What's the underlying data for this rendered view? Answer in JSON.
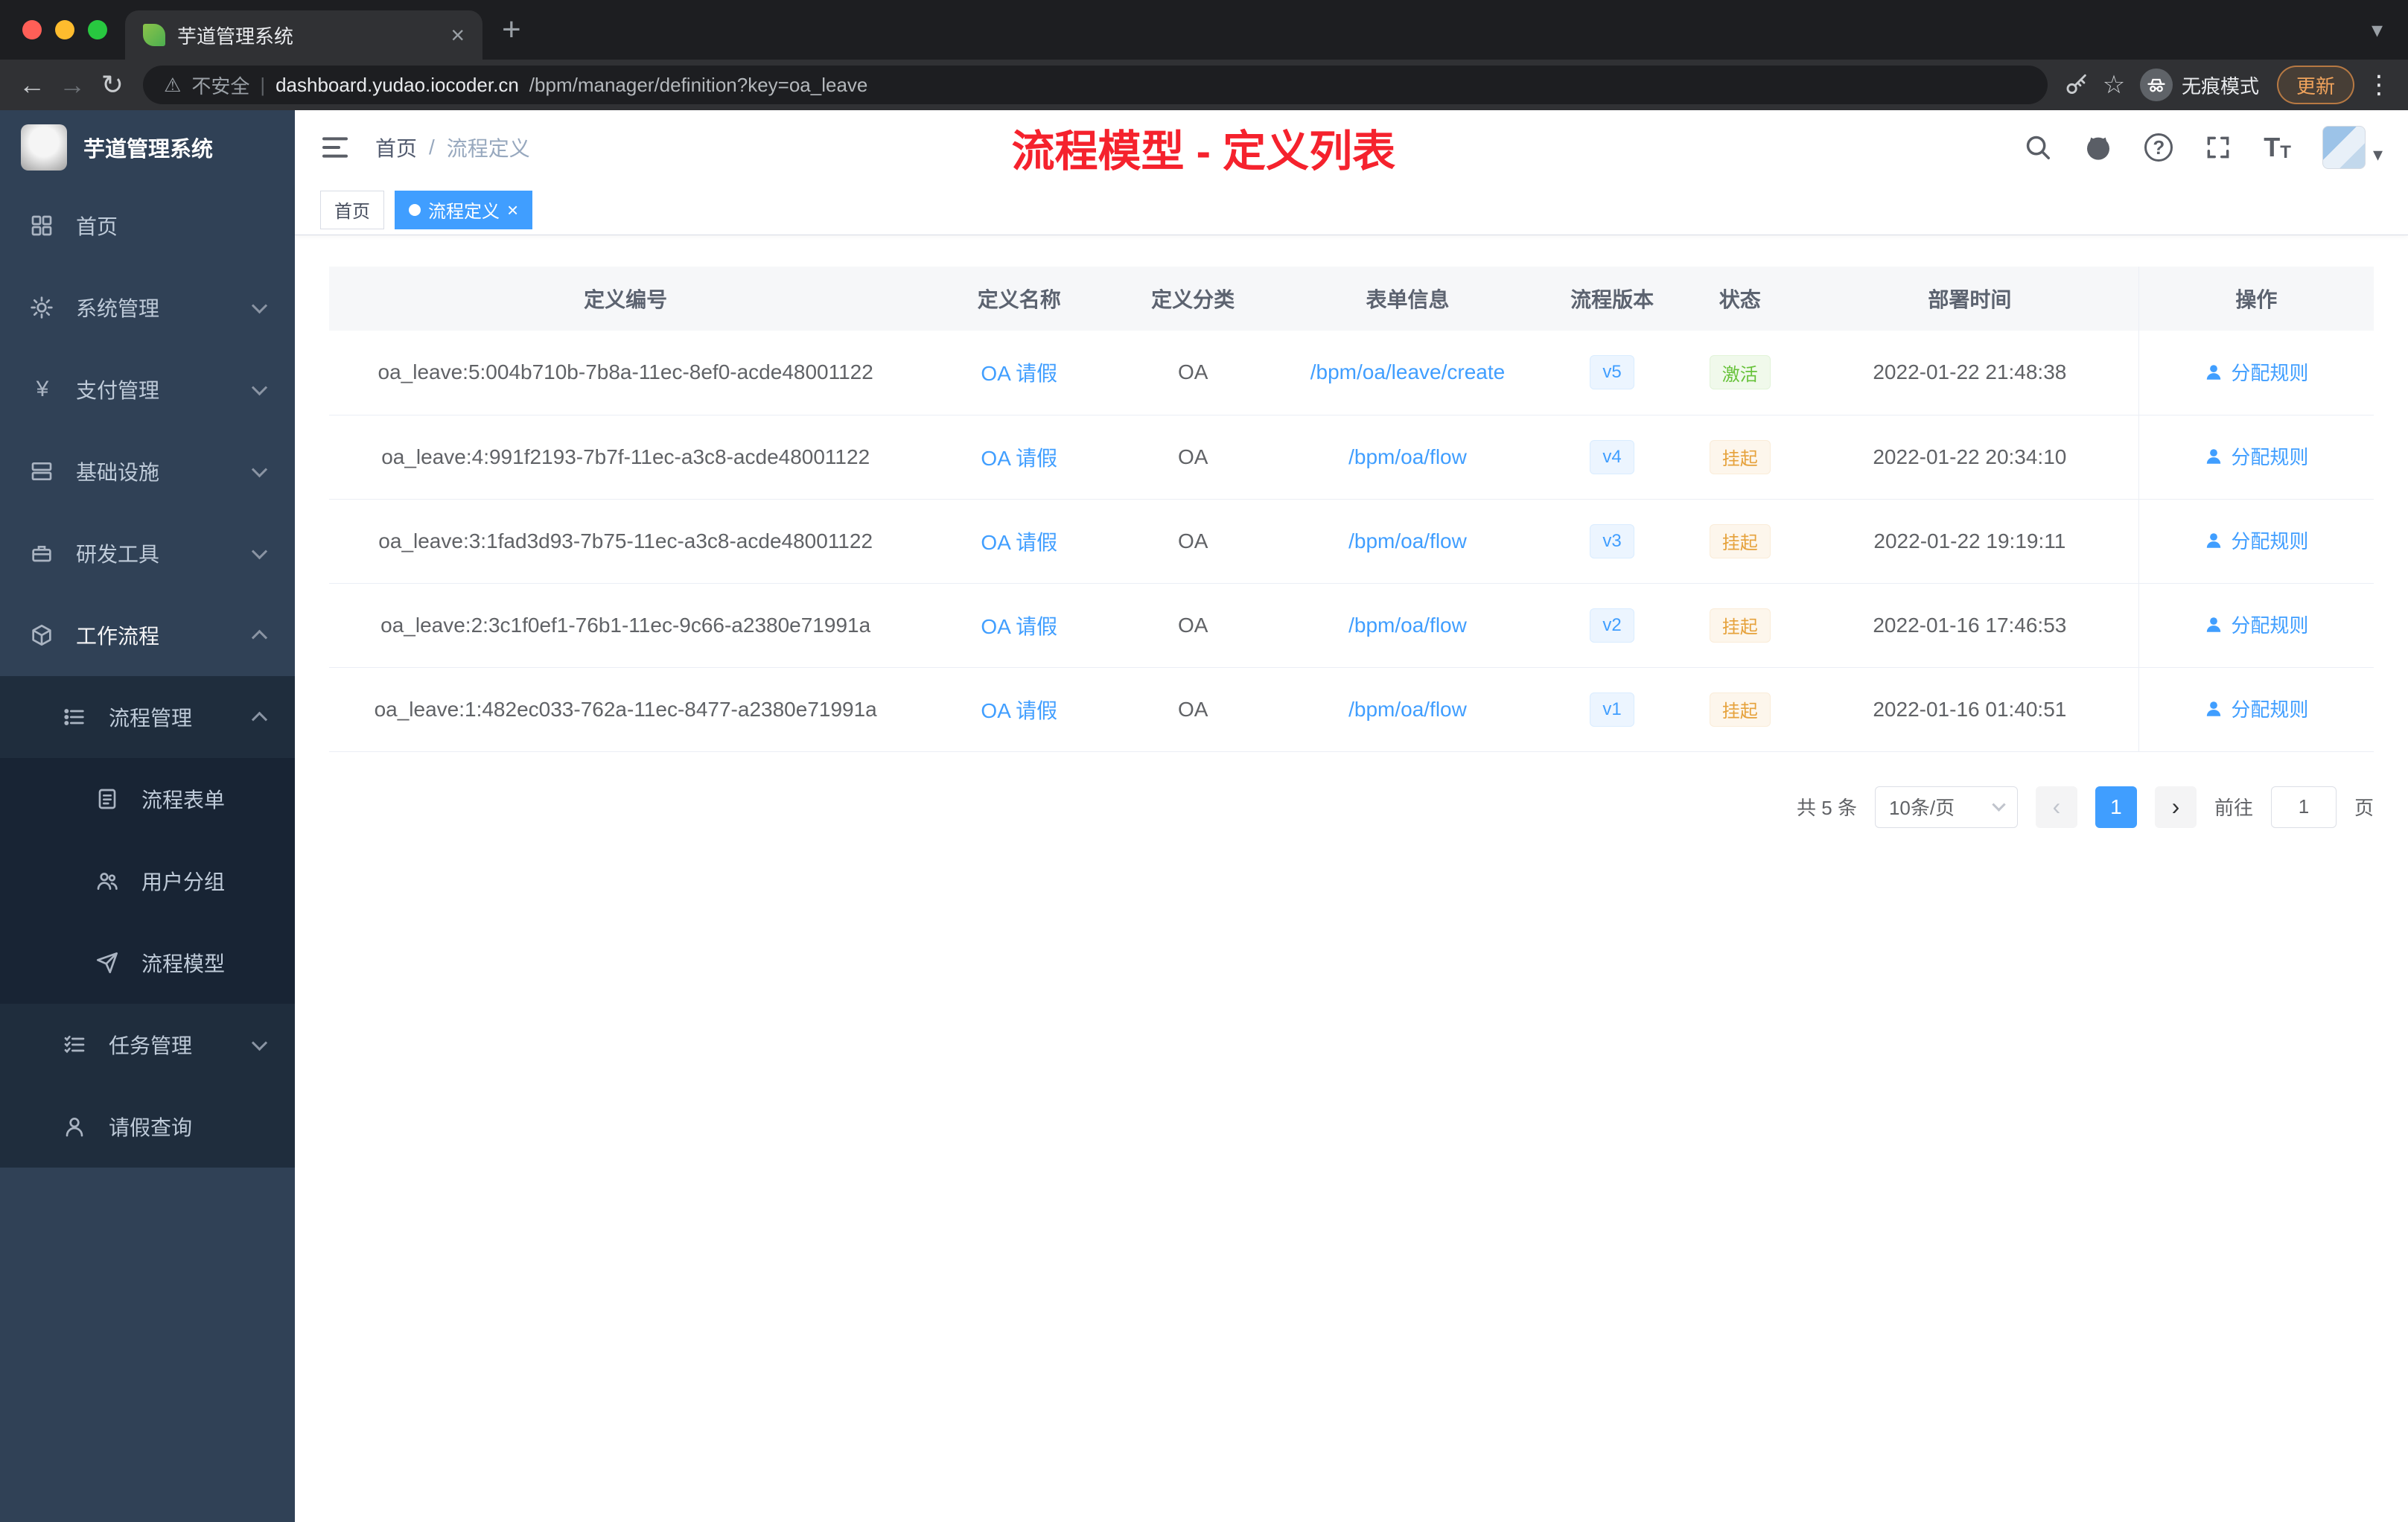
{
  "browser": {
    "tab_title": "芋道管理系统",
    "security_label": "不安全",
    "url_domain": "dashboard.yudao.iocoder.cn",
    "url_path": "/bpm/manager/definition?key=oa_leave",
    "incognito_label": "无痕模式",
    "update_label": "更新"
  },
  "icons": {
    "back": "←",
    "forward": "→",
    "reload": "↻",
    "warning": "⚠",
    "divider": "|",
    "star": "☆",
    "kebab": "⋮",
    "new_tab": "+",
    "tab_close": "×",
    "tab_search": "▾",
    "caret": "▾",
    "tag_close": "×",
    "prev": "‹",
    "next": "›",
    "yen": "¥",
    "help": "?",
    "font_size": "T"
  },
  "sidebar": {
    "logo_title": "芋道管理系统",
    "items": [
      {
        "label": "首页"
      },
      {
        "label": "系统管理"
      },
      {
        "label": "支付管理"
      },
      {
        "label": "基础设施"
      },
      {
        "label": "研发工具"
      },
      {
        "label": "工作流程"
      },
      {
        "label": "流程管理"
      },
      {
        "label": "流程表单"
      },
      {
        "label": "用户分组"
      },
      {
        "label": "流程模型"
      },
      {
        "label": "任务管理"
      },
      {
        "label": "请假查询"
      }
    ]
  },
  "navbar": {
    "breadcrumb_home": "首页",
    "breadcrumb_sep": "/",
    "breadcrumb_current": "流程定义",
    "annotation": "流程模型 - 定义列表"
  },
  "tags": {
    "home": "首页",
    "active": "流程定义"
  },
  "table": {
    "headers": [
      "定义编号",
      "定义名称",
      "定义分类",
      "表单信息",
      "流程版本",
      "状态",
      "部署时间",
      "操作"
    ],
    "action_label": "分配规则",
    "rows": [
      {
        "id": "oa_leave:5:004b710b-7b8a-11ec-8ef0-acde48001122",
        "name": "OA 请假",
        "category": "OA",
        "form": "/bpm/oa/leave/create",
        "version": "v5",
        "status": "激活",
        "time": "2022-01-22 21:48:38"
      },
      {
        "id": "oa_leave:4:991f2193-7b7f-11ec-a3c8-acde48001122",
        "name": "OA 请假",
        "category": "OA",
        "form": "/bpm/oa/flow",
        "version": "v4",
        "status": "挂起",
        "time": "2022-01-22 20:34:10"
      },
      {
        "id": "oa_leave:3:1fad3d93-7b75-11ec-a3c8-acde48001122",
        "name": "OA 请假",
        "category": "OA",
        "form": "/bpm/oa/flow",
        "version": "v3",
        "status": "挂起",
        "time": "2022-01-22 19:19:11"
      },
      {
        "id": "oa_leave:2:3c1f0ef1-76b1-11ec-9c66-a2380e71991a",
        "name": "OA 请假",
        "category": "OA",
        "form": "/bpm/oa/flow",
        "version": "v2",
        "status": "挂起",
        "time": "2022-01-16 17:46:53"
      },
      {
        "id": "oa_leave:1:482ec033-762a-11ec-8477-a2380e71991a",
        "name": "OA 请假",
        "category": "OA",
        "form": "/bpm/oa/flow",
        "version": "v1",
        "status": "挂起",
        "time": "2022-01-16 01:40:51"
      }
    ]
  },
  "pagination": {
    "total": "共 5 条",
    "page_size": "10条/页",
    "current_page": "1",
    "goto_label": "前往",
    "goto_value": "1",
    "goto_unit": "页"
  },
  "colors": {
    "primary": "#409eff",
    "success": "#67c23a",
    "warning": "#e6a23c",
    "annotation_red": "#f5222d"
  }
}
